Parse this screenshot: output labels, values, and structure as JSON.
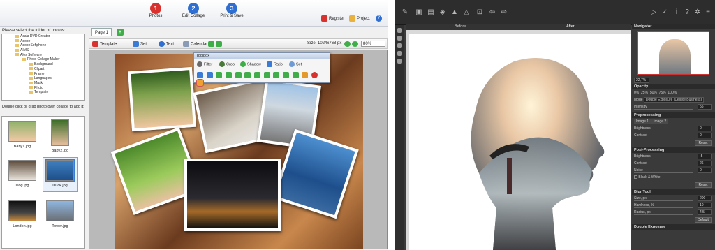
{
  "left": {
    "toolbar": {
      "photos": "Photos",
      "edit_collage": "Edit Collage",
      "print_save": "Print & Save",
      "register": "Register",
      "project": "Project",
      "help": "?"
    },
    "folder_label": "Please select the folder of photos:",
    "tree": [
      "Acala DVD Creator",
      "Adobe",
      "AdobeSoftphone",
      "AIMS",
      "Ales Software",
      "Photo Collage Maker",
      "Background",
      "Clipart",
      "Frame",
      "Languages",
      "Mask",
      "Photo",
      "Template"
    ],
    "hint": "Double click or drag photo over collage to add it:",
    "thumbs": [
      "Baby1.jpg",
      "Baby2.jpg",
      "Dog.jpg",
      "Duck.jpg",
      "London.jpg",
      "Tower.jpg"
    ],
    "tab": "Page 1",
    "edit_toolbar": {
      "template": "Template",
      "set": "Set",
      "text": "Text",
      "calendar": "Calendar",
      "size": "Size: 1024x768 px",
      "zoom": "80%"
    },
    "toolbox": {
      "title": "Toolbox",
      "filter": "Filter",
      "crop": "Crop",
      "shadow": "Shadow",
      "ratio": "Ratio",
      "set": "Set"
    }
  },
  "right": {
    "before": "Before",
    "after": "After",
    "navigator": "Navigator",
    "zoom": "22,7%",
    "opacity": "Opacity",
    "opacity_opts": [
      "0%",
      "25%",
      "50%",
      "75%",
      "100%"
    ],
    "mode_label": "Mode",
    "mode_value": "Double Exposure (Deluxe/Business)",
    "intensity_label": "Intensity",
    "intensity_value": "55",
    "preprocessing": "Preprocessing",
    "image_tabs": [
      "Image 1",
      "Image 2"
    ],
    "brightness": "Brightness",
    "brightness_value": "0",
    "contrast": "Contrast",
    "contrast_value": "0",
    "reset": "Reset",
    "postprocessing": "Post-Processing",
    "pp_brightness_value": "-5",
    "pp_contrast_value": "26",
    "noise": "Noise",
    "noise_value": "0",
    "black_white": "Black & White",
    "blur_tool": "Blur Tool",
    "size_px": "Size, px",
    "size_value": "200",
    "hardness": "Hardness, %",
    "hardness_value": "10",
    "radius": "Radius, px",
    "radius_value": "4.5",
    "default": "Default",
    "double_exposure": "Double Exposure"
  }
}
